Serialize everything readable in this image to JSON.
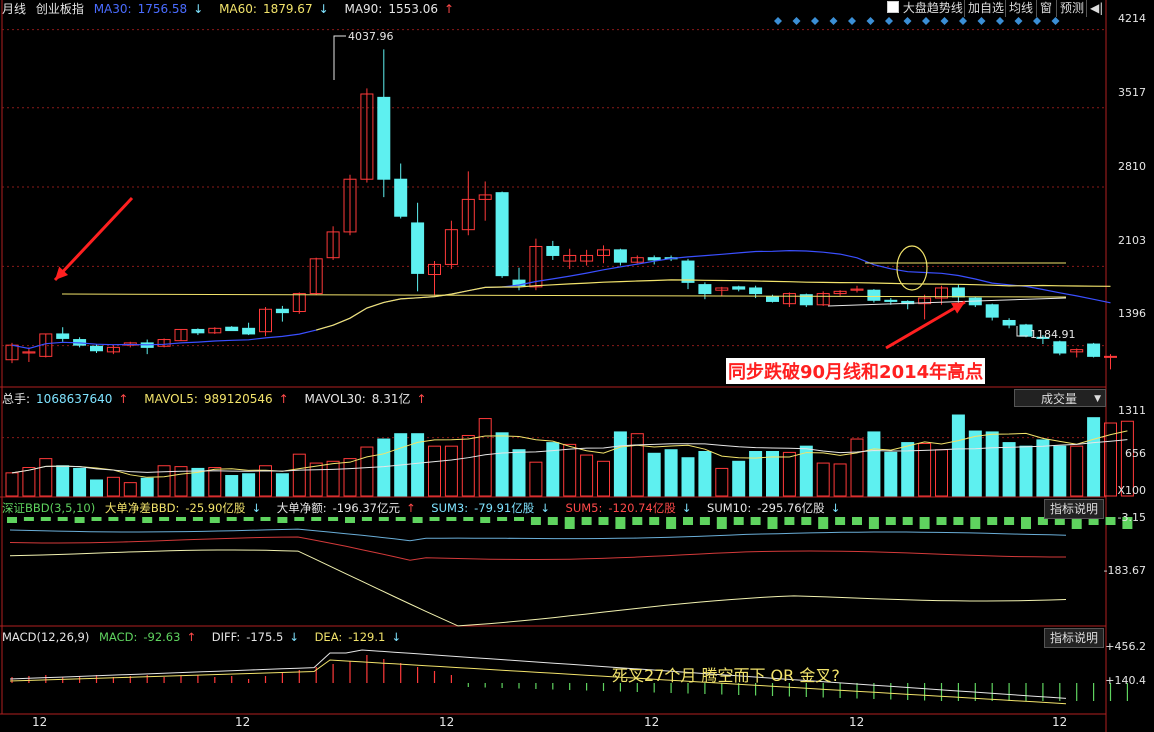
{
  "header": {
    "period": "月线",
    "index_name": "创业板指",
    "ma30": {
      "label": "MA30:",
      "value": "1756.58",
      "dir": "↓",
      "color": "#4a6cff"
    },
    "ma60": {
      "label": "MA60:",
      "value": "1879.67",
      "dir": "↓",
      "color": "#f2e36b"
    },
    "ma90": {
      "label": "MA90:",
      "value": "1553.06",
      "dir": "↑",
      "color": "#e6e6e6"
    },
    "toolbar": {
      "trend_checkbox_label": "大盘趋势线",
      "add_fav": "加自选",
      "avg_line": "均线",
      "window": "窗",
      "forecast": "预测",
      "back": "◀|"
    }
  },
  "price_axis": {
    "ticks": [
      "4214",
      "3517",
      "2810",
      "2103",
      "1396"
    ]
  },
  "price_annotations": {
    "high": "4037.96",
    "low": "1184.91",
    "note": "同步跌破90月线和2014年高点"
  },
  "volume": {
    "total_label": "总手:",
    "total_value": "1068637640",
    "total_dir": "↑",
    "mavol5_label": "MAVOL5:",
    "mavol5_value": "989120546",
    "mavol5_dir": "↑",
    "mavol30_label": "MAVOL30:",
    "mavol30_value": "8.31亿",
    "mavol30_dir": "↑",
    "dropdown": "成交量",
    "ticks": [
      "1311",
      "656",
      "X100"
    ]
  },
  "bbd": {
    "title": "深证BBD(3,5,10)",
    "net_label": "大单净差BBD:",
    "net_value": "-25.90亿股",
    "net_dir": "↓",
    "amt_label": "大单净额:",
    "amt_value": "-196.37亿元",
    "amt_dir": "↑",
    "sum3_label": "SUM3:",
    "sum3_value": "-79.91亿股",
    "sum3_dir": "↓",
    "sum5_label": "SUM5:",
    "sum5_value": "-120.74亿股",
    "sum5_dir": "↓",
    "sum10_label": "SUM10:",
    "sum10_value": "-295.76亿股",
    "sum10_dir": "↓",
    "help": "指标说明",
    "ticks": [
      "-3.15",
      "-183.67"
    ]
  },
  "macd": {
    "title": "MACD(12,26,9)",
    "macd_label": "MACD:",
    "macd_value": "-92.63",
    "macd_dir": "↑",
    "diff_label": "DIFF:",
    "diff_value": "-175.5",
    "diff_dir": "↓",
    "dea_label": "DEA:",
    "dea_value": "-129.1",
    "dea_dir": "↓",
    "help": "指标说明",
    "ticks": [
      "+456.2",
      "+140.4"
    ],
    "note": "死叉27个月  腾空而下 OR 金叉?"
  },
  "x_axis": {
    "labels": [
      "12",
      "12",
      "12",
      "12",
      "12",
      "12"
    ]
  },
  "candles": [
    {
      "o": 1270,
      "h": 1420,
      "l": 1240,
      "c": 1400
    },
    {
      "o": 1330,
      "h": 1380,
      "l": 1250,
      "c": 1340
    },
    {
      "o": 1300,
      "h": 1500,
      "l": 1290,
      "c": 1500
    },
    {
      "o": 1500,
      "h": 1560,
      "l": 1430,
      "c": 1460
    },
    {
      "o": 1450,
      "h": 1470,
      "l": 1380,
      "c": 1400
    },
    {
      "o": 1390,
      "h": 1410,
      "l": 1330,
      "c": 1350
    },
    {
      "o": 1340,
      "h": 1400,
      "l": 1320,
      "c": 1380
    },
    {
      "o": 1400,
      "h": 1430,
      "l": 1380,
      "c": 1420
    },
    {
      "o": 1420,
      "h": 1450,
      "l": 1320,
      "c": 1380
    },
    {
      "o": 1390,
      "h": 1460,
      "l": 1380,
      "c": 1450
    },
    {
      "o": 1440,
      "h": 1540,
      "l": 1440,
      "c": 1540
    },
    {
      "o": 1540,
      "h": 1550,
      "l": 1490,
      "c": 1510
    },
    {
      "o": 1510,
      "h": 1560,
      "l": 1500,
      "c": 1550
    },
    {
      "o": 1560,
      "h": 1570,
      "l": 1530,
      "c": 1530
    },
    {
      "o": 1550,
      "h": 1600,
      "l": 1490,
      "c": 1500
    },
    {
      "o": 1520,
      "h": 1740,
      "l": 1480,
      "c": 1720
    },
    {
      "o": 1720,
      "h": 1750,
      "l": 1610,
      "c": 1690
    },
    {
      "o": 1700,
      "h": 1870,
      "l": 1680,
      "c": 1860
    },
    {
      "o": 1860,
      "h": 2180,
      "l": 1850,
      "c": 2170
    },
    {
      "o": 2180,
      "h": 2460,
      "l": 2160,
      "c": 2410
    },
    {
      "o": 2410,
      "h": 2920,
      "l": 2380,
      "c": 2880
    },
    {
      "o": 2880,
      "h": 3690,
      "l": 2850,
      "c": 3640
    },
    {
      "o": 3610,
      "h": 4038,
      "l": 2720,
      "c": 2880
    },
    {
      "o": 2880,
      "h": 3020,
      "l": 2530,
      "c": 2550
    },
    {
      "o": 2490,
      "h": 2670,
      "l": 1880,
      "c": 2040
    },
    {
      "o": 2030,
      "h": 2150,
      "l": 1840,
      "c": 2120
    },
    {
      "o": 2120,
      "h": 2510,
      "l": 2080,
      "c": 2430
    },
    {
      "o": 2430,
      "h": 2950,
      "l": 2380,
      "c": 2700
    },
    {
      "o": 2700,
      "h": 2860,
      "l": 2510,
      "c": 2740
    },
    {
      "o": 2760,
      "h": 2770,
      "l": 2000,
      "c": 2020
    },
    {
      "o": 1980,
      "h": 2090,
      "l": 1890,
      "c": 1930
    },
    {
      "o": 1920,
      "h": 2350,
      "l": 1890,
      "c": 2280
    },
    {
      "o": 2280,
      "h": 2330,
      "l": 2160,
      "c": 2200
    },
    {
      "o": 2150,
      "h": 2260,
      "l": 2080,
      "c": 2200
    },
    {
      "o": 2150,
      "h": 2250,
      "l": 2110,
      "c": 2200
    },
    {
      "o": 2200,
      "h": 2290,
      "l": 2130,
      "c": 2250
    },
    {
      "o": 2250,
      "h": 2260,
      "l": 2110,
      "c": 2140
    },
    {
      "o": 2140,
      "h": 2200,
      "l": 2130,
      "c": 2180
    },
    {
      "o": 2180,
      "h": 2200,
      "l": 2120,
      "c": 2160
    },
    {
      "o": 2180,
      "h": 2200,
      "l": 2150,
      "c": 2170
    },
    {
      "o": 2150,
      "h": 2170,
      "l": 1900,
      "c": 1960
    },
    {
      "o": 1940,
      "h": 1960,
      "l": 1810,
      "c": 1860
    },
    {
      "o": 1890,
      "h": 1920,
      "l": 1840,
      "c": 1910
    },
    {
      "o": 1920,
      "h": 1930,
      "l": 1880,
      "c": 1900
    },
    {
      "o": 1910,
      "h": 1930,
      "l": 1820,
      "c": 1860
    },
    {
      "o": 1830,
      "h": 1850,
      "l": 1780,
      "c": 1790
    },
    {
      "o": 1770,
      "h": 1870,
      "l": 1740,
      "c": 1860
    },
    {
      "o": 1850,
      "h": 1860,
      "l": 1740,
      "c": 1760
    },
    {
      "o": 1760,
      "h": 1880,
      "l": 1750,
      "c": 1860
    },
    {
      "o": 1860,
      "h": 1890,
      "l": 1840,
      "c": 1880
    },
    {
      "o": 1890,
      "h": 1930,
      "l": 1870,
      "c": 1900
    },
    {
      "o": 1890,
      "h": 1900,
      "l": 1780,
      "c": 1800
    },
    {
      "o": 1800,
      "h": 1820,
      "l": 1760,
      "c": 1790
    },
    {
      "o": 1790,
      "h": 1800,
      "l": 1720,
      "c": 1770
    },
    {
      "o": 1770,
      "h": 1850,
      "l": 1630,
      "c": 1820
    },
    {
      "o": 1820,
      "h": 1930,
      "l": 1760,
      "c": 1910
    },
    {
      "o": 1910,
      "h": 1940,
      "l": 1760,
      "c": 1830
    },
    {
      "o": 1820,
      "h": 1830,
      "l": 1740,
      "c": 1760
    },
    {
      "o": 1760,
      "h": 1770,
      "l": 1620,
      "c": 1650
    },
    {
      "o": 1620,
      "h": 1640,
      "l": 1550,
      "c": 1580
    },
    {
      "o": 1580,
      "h": 1590,
      "l": 1470,
      "c": 1480
    },
    {
      "o": 1470,
      "h": 1490,
      "l": 1410,
      "c": 1460
    },
    {
      "o": 1430,
      "h": 1440,
      "l": 1310,
      "c": 1330
    },
    {
      "o": 1340,
      "h": 1370,
      "l": 1290,
      "c": 1360
    },
    {
      "o": 1410,
      "h": 1420,
      "l": 1290,
      "c": 1300
    },
    {
      "o": 1300,
      "h": 1320,
      "l": 1184,
      "c": 1300
    }
  ],
  "volumes": [
    260,
    320,
    420,
    340,
    310,
    180,
    210,
    150,
    200,
    340,
    330,
    310,
    320,
    230,
    250,
    340,
    250,
    470,
    370,
    390,
    420,
    550,
    640,
    700,
    700,
    560,
    560,
    680,
    870,
    710,
    520,
    380,
    600,
    580,
    460,
    390,
    720,
    700,
    480,
    520,
    430,
    500,
    310,
    390,
    500,
    500,
    490,
    560,
    370,
    360,
    640,
    720,
    490,
    600,
    590,
    520,
    910,
    730,
    720,
    600,
    560,
    630,
    560,
    560,
    880,
    820,
    840
  ],
  "trend_line_text": "",
  "chart_data": {
    "type": "candlestick"
  }
}
